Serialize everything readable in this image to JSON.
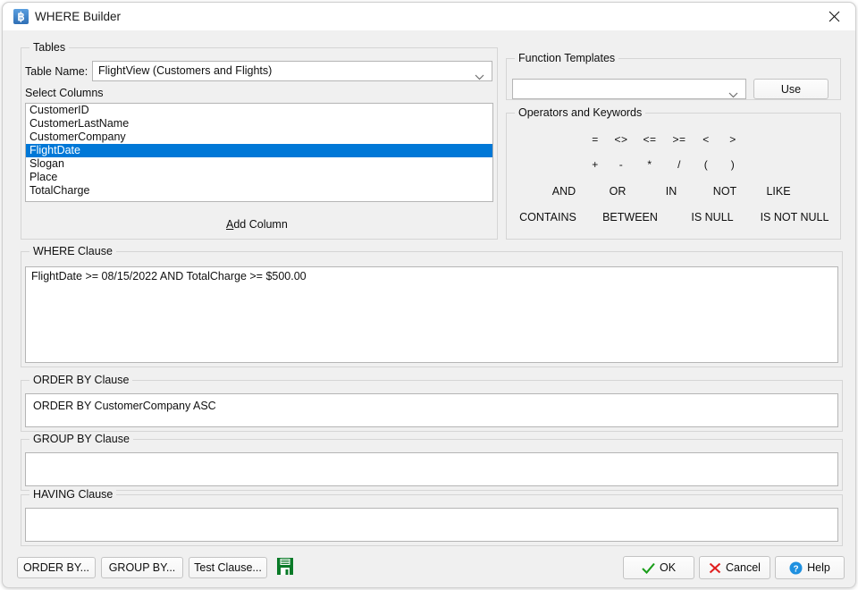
{
  "window": {
    "title": "WHERE Builder",
    "app_icon": "app-icon",
    "close_label": "×"
  },
  "tables": {
    "legend": "Tables",
    "table_name_label": "Table Name:",
    "table_name_value": "FlightView  (Customers and Flights)",
    "select_columns_label": "Select Columns",
    "columns": [
      {
        "name": "CustomerID",
        "selected": false
      },
      {
        "name": "CustomerLastName",
        "selected": false
      },
      {
        "name": "CustomerCompany",
        "selected": false
      },
      {
        "name": "FlightDate",
        "selected": true
      },
      {
        "name": "Slogan",
        "selected": false
      },
      {
        "name": "Place",
        "selected": false
      },
      {
        "name": "TotalCharge",
        "selected": false
      }
    ],
    "add_column_accel": "A",
    "add_column_rest": "dd Column"
  },
  "function_templates": {
    "legend": "Function Templates",
    "value": "",
    "use_label": "Use"
  },
  "operators": {
    "legend": "Operators and Keywords",
    "row1": [
      "=",
      "<>",
      "<=",
      ">=",
      "<",
      ">"
    ],
    "row2": [
      "+",
      "-",
      "*",
      "/",
      "(",
      ")"
    ],
    "row3": [
      "AND",
      "OR",
      "IN",
      "NOT",
      "LIKE"
    ],
    "row4": [
      "CONTAINS",
      "BETWEEN",
      "IS NULL",
      "IS NOT NULL"
    ]
  },
  "clauses": {
    "where": {
      "legend": "WHERE Clause",
      "value": "FlightDate  >= 08/15/2022 AND  TotalCharge  >= $500.00"
    },
    "order_by": {
      "legend": "ORDER BY Clause",
      "value": "ORDER BY CustomerCompany ASC"
    },
    "group_by": {
      "legend": "GROUP BY Clause",
      "value": ""
    },
    "having": {
      "legend": "HAVING Clause",
      "value": ""
    }
  },
  "bottom_bar": {
    "order_by_button": "ORDER BY...",
    "group_by_button": "GROUP BY...",
    "test_clause_button": "Test Clause...",
    "save_icon": "save-floppy-icon",
    "ok_button": "OK",
    "cancel_button": "Cancel",
    "help_button": "Help"
  },
  "colors": {
    "selection": "#0078d7",
    "ok_check": "#1a9e1a",
    "cancel_x": "#e02020",
    "help_blue": "#1e90e0",
    "save_green": "#0a7a28",
    "window_bg": "#f0f0f0"
  }
}
